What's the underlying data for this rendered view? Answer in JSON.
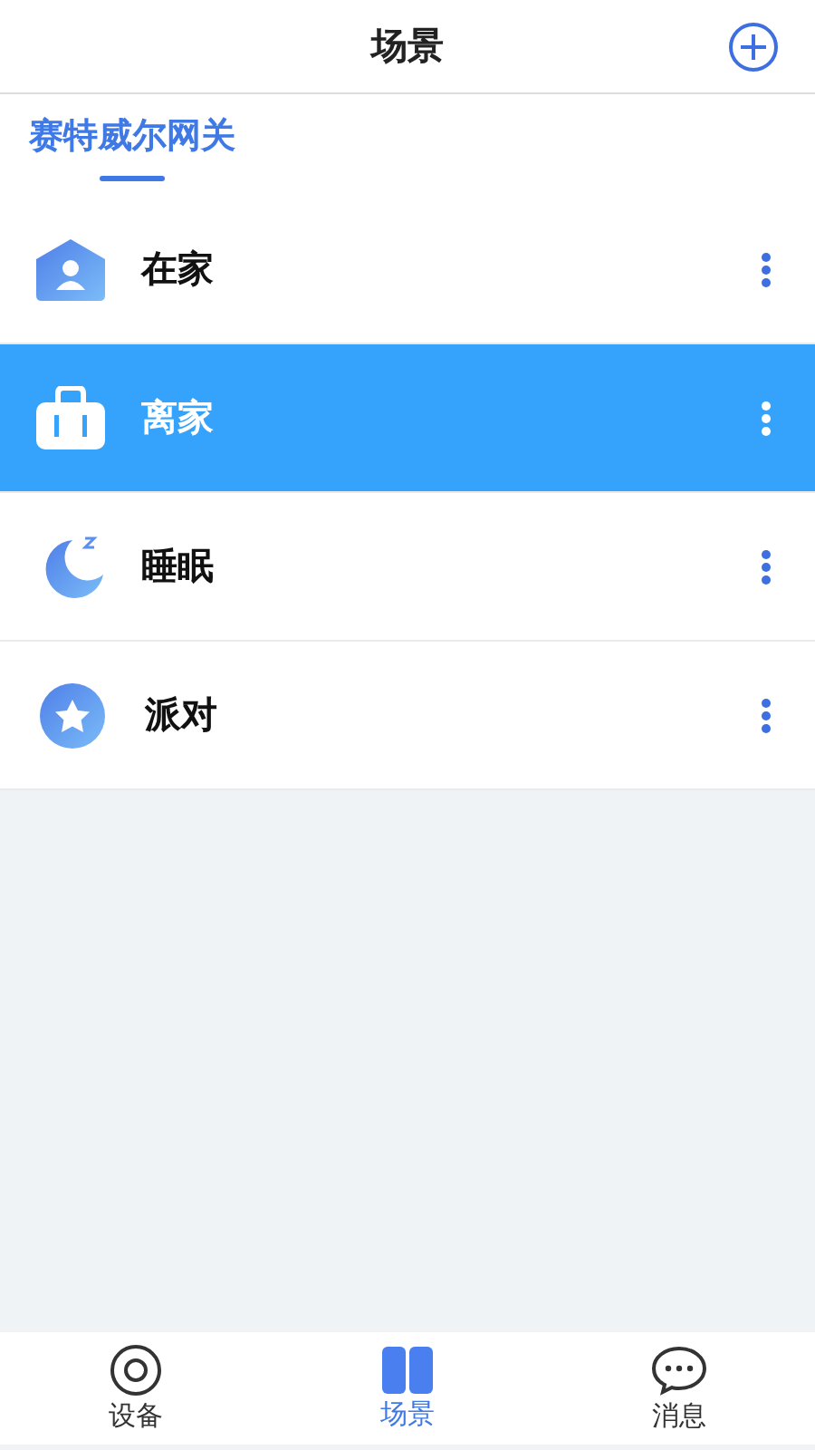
{
  "header": {
    "title": "场景"
  },
  "gateway_tabs": [
    {
      "label": "赛特威尔网关",
      "selected": true
    }
  ],
  "scenes": [
    {
      "name": "在家",
      "kind": "home",
      "selected": false
    },
    {
      "name": "离家",
      "kind": "luggage",
      "selected": true
    },
    {
      "name": "睡眠",
      "kind": "moon",
      "selected": false
    },
    {
      "name": "派对",
      "kind": "star",
      "selected": false
    }
  ],
  "bottom_nav": [
    {
      "label": "设备",
      "kind": "device",
      "selected": false
    },
    {
      "label": "场景",
      "kind": "scene",
      "selected": true
    },
    {
      "label": "消息",
      "kind": "message",
      "selected": false
    }
  ]
}
